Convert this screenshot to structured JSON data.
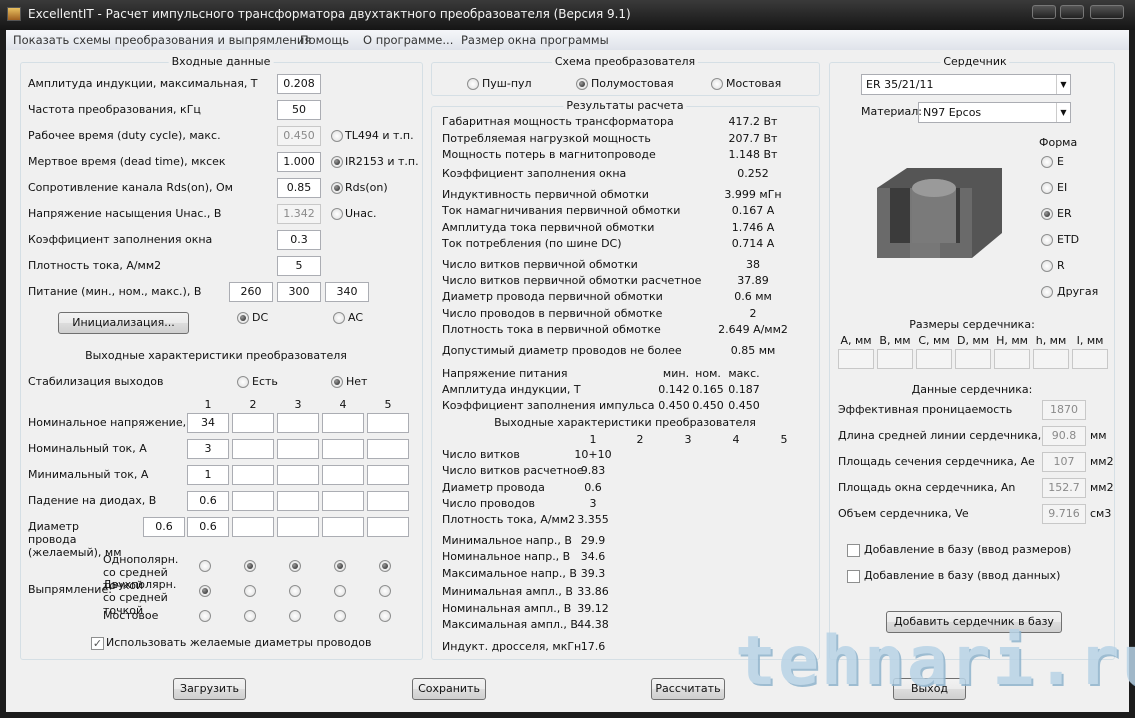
{
  "window": {
    "title": "ExcellentIT - Расчет импульсного трансформатора двухтактного преобразователя (Версия 9.1)"
  },
  "menu": [
    "Показать схемы преобразования и выпрямления",
    "Помощь",
    "О программе...",
    "Размер окна программы"
  ],
  "input": {
    "title": "Входные данные",
    "rows": [
      {
        "label": "Амплитуда индукции, максимальная, Т",
        "value": "0.208",
        "disabled": false
      },
      {
        "label": "Частота преобразования, кГц",
        "value": "50",
        "disabled": false
      },
      {
        "label": "Рабочее время (duty cycle), макс.",
        "value": "0.450",
        "disabled": true
      },
      {
        "label": "Мертвое время (dead time), мксек",
        "value": "1.000",
        "disabled": false
      },
      {
        "label": "Сопротивление канала Rds(on), Ом",
        "value": "0.85",
        "disabled": false
      },
      {
        "label": "Напряжение насыщения Uнас., В",
        "value": "1.342",
        "disabled": true
      },
      {
        "label": "Коэффициент заполнения окна",
        "value": "0.3",
        "disabled": false
      },
      {
        "label": "Плотность тока, А/мм2",
        "value": "5",
        "disabled": false
      }
    ],
    "options": [
      {
        "label": "TL494 и т.п.",
        "checked": false
      },
      {
        "label": "IR2153 и т.п.",
        "checked": true
      },
      {
        "label": "Rds(on)",
        "checked": true
      },
      {
        "label": "Uнас.",
        "checked": false
      }
    ],
    "supply": {
      "label": "Питание (мин., ном., макс.), В",
      "values": [
        "260",
        "300",
        "340"
      ]
    },
    "init_button": "Инициализация...",
    "dc": {
      "label": "DC",
      "checked": true
    },
    "ac": {
      "label": "AC",
      "checked": false
    }
  },
  "outputs": {
    "title": "Выходные характеристики преобразователя",
    "stab_label": "Стабилизация выходов",
    "stab_yes": "Есть",
    "stab_no": "Нет",
    "stab_value": "Нет",
    "columns": [
      "1",
      "2",
      "3",
      "4",
      "5"
    ],
    "rows": [
      {
        "label": "Номинальное напряжение, В",
        "values": [
          "34",
          "",
          "",
          "",
          ""
        ]
      },
      {
        "label": "Номинальный ток, А",
        "values": [
          "3",
          "",
          "",
          "",
          ""
        ]
      },
      {
        "label": "Минимальный ток, А",
        "values": [
          "1",
          "",
          "",
          "",
          ""
        ]
      },
      {
        "label": "Падение на диодах, В",
        "values": [
          "0.6",
          "",
          "",
          "",
          ""
        ]
      },
      {
        "label": "Диаметр провода (желаемый), мм",
        "extra": "0.6",
        "values": [
          "0.6",
          "",
          "",
          "",
          ""
        ]
      }
    ],
    "rect_label": "Выпрямление:",
    "rect_rows": [
      {
        "label": "Однополярн. со средней точкой",
        "checked": [
          false,
          true,
          true,
          true,
          true
        ]
      },
      {
        "label": "Двухполярн. со средней точкой",
        "checked": [
          true,
          false,
          false,
          false,
          false
        ]
      },
      {
        "label": "Мостовое",
        "checked": [
          false,
          false,
          false,
          false,
          false
        ]
      }
    ],
    "use_wire_label": "Использовать желаемые диаметры проводов",
    "use_wire_checked": true
  },
  "scheme": {
    "title": "Схема преобразователя",
    "options": [
      {
        "label": "Пуш-пул",
        "checked": false
      },
      {
        "label": "Полумостовая",
        "checked": true
      },
      {
        "label": "Мостовая",
        "checked": false
      }
    ]
  },
  "results": {
    "title": "Результаты расчета",
    "rows": [
      {
        "label": "Габаритная мощность трансформатора",
        "value": "417.2 Вт"
      },
      {
        "label": "Потребляемая нагрузкой мощность",
        "value": "207.7 Вт"
      },
      {
        "label": "Мощность потерь в магнитопроводе",
        "value": "1.148 Вт"
      },
      {
        "label": "Коэффициент заполнения окна",
        "value": "0.252"
      },
      {
        "label": "Индуктивность первичной обмотки",
        "value": "3.999 мГн"
      },
      {
        "label": "Ток намагничивания первичной обмотки",
        "value": "0.167 А"
      },
      {
        "label": "Амплитуда тока первичной обмотки",
        "value": "1.746 А"
      },
      {
        "label": "Ток потребления (по шине DC)",
        "value": "0.714 А"
      },
      {
        "label": "Число витков первичной обмотки",
        "value": "38"
      },
      {
        "label": "Число витков первичной обмотки расчетное",
        "value": "37.89"
      },
      {
        "label": "Диаметр провода первичной обмотки",
        "value": "0.6 мм"
      },
      {
        "label": "Число проводов в первичной обмотке",
        "value": "2"
      },
      {
        "label": "Плотность тока в первичной обмотке",
        "value": "2.649 А/мм2"
      },
      {
        "label": "Допустимый диаметр проводов не более",
        "value": "0.85 мм"
      }
    ],
    "supply_header": {
      "label": "Напряжение питания",
      "cols": [
        "мин.",
        "ном.",
        "макс."
      ]
    },
    "supply_rows": [
      {
        "label": "Амплитуда индукции, Т",
        "values": [
          "0.142",
          "0.165",
          "0.187"
        ]
      },
      {
        "label": "Коэффициент заполнения импульса",
        "values": [
          "0.450",
          "0.450",
          "0.450"
        ]
      }
    ],
    "out_title": "Выходные характеристики преобразователя",
    "out_columns": [
      "1",
      "2",
      "3",
      "4",
      "5"
    ],
    "out_rows": [
      {
        "label": "Число витков",
        "value": "10+10"
      },
      {
        "label": "Число витков расчетное",
        "value": "9.83"
      },
      {
        "label": "Диаметр провода",
        "value": "0.6"
      },
      {
        "label": "Число проводов",
        "value": "3"
      },
      {
        "label": "Плотность тока, А/мм2",
        "value": "3.355"
      },
      {
        "label": "Минимальное напр., В",
        "value": "29.9"
      },
      {
        "label": "Номинальное напр., В",
        "value": "34.6"
      },
      {
        "label": "Максимальное напр., В",
        "value": "39.3"
      },
      {
        "label": "Минимальная ампл., В",
        "value": "33.86"
      },
      {
        "label": "Номинальная ампл., В",
        "value": "39.12"
      },
      {
        "label": "Максимальная ампл., В",
        "value": "44.38"
      },
      {
        "label": "Индукт. дросселя, мкГн",
        "value": "17.6"
      }
    ]
  },
  "core": {
    "title": "Сердечник",
    "selected": "ER 35/21/11",
    "material_label": "Материал:",
    "material": "N97 Epcos",
    "shape_label": "Форма",
    "shapes": [
      {
        "label": "E",
        "checked": false
      },
      {
        "label": "EI",
        "checked": false
      },
      {
        "label": "ER",
        "checked": true
      },
      {
        "label": "ETD",
        "checked": false
      },
      {
        "label": "R",
        "checked": false
      },
      {
        "label": "Другая",
        "checked": false
      }
    ],
    "sizes_title": "Размеры сердечника:",
    "sizes": [
      "A, мм",
      "B, мм",
      "C, мм",
      "D, мм",
      "H, мм",
      "h, мм",
      "I, мм"
    ],
    "data_title": "Данные сердечника:",
    "data": [
      {
        "label": "Эффективная проницаемость",
        "value": "1870",
        "unit": ""
      },
      {
        "label": "Длина средней линии сердечника, le",
        "value": "90.8",
        "unit": "мм"
      },
      {
        "label": "Площадь сечения сердечника, Ae",
        "value": "107",
        "unit": "мм2"
      },
      {
        "label": "Площадь окна сердечника, An",
        "value": "152.7",
        "unit": "мм2"
      },
      {
        "label": "Объем сердечника, Ve",
        "value": "9.716",
        "unit": "см3"
      }
    ],
    "add_sizes": "Добавление в базу (ввод размеров)",
    "add_data": "Добавление в базу (ввод данных)",
    "add_button": "Добавить сердечник в базу"
  },
  "buttons": {
    "load": "Загрузить",
    "save": "Сохранить",
    "calc": "Рассчитать",
    "exit": "Выход"
  },
  "watermark": "tehnari.ru"
}
